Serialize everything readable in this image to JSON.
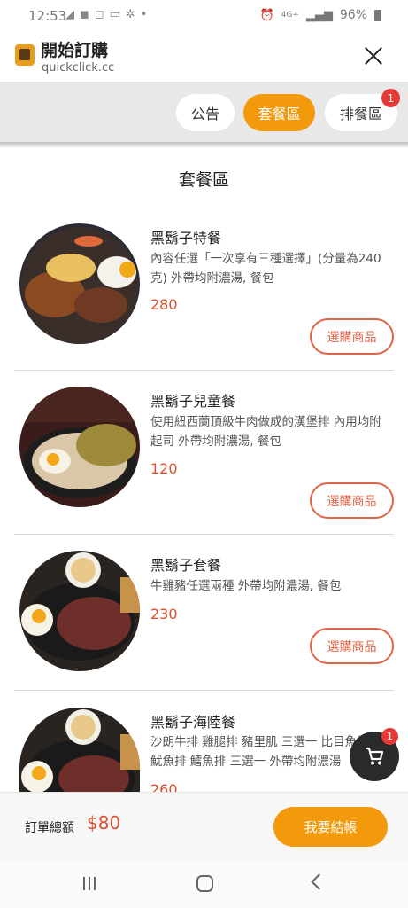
{
  "status_bar": {
    "time": "12:53",
    "left_icons": [
      "telegram-icon",
      "facebook-icon",
      "instagram-icon",
      "line-icon",
      "pinwheel-icon",
      "dot-icon"
    ],
    "signal_text": "4G+",
    "battery": "96%"
  },
  "browser": {
    "title": "開始訂購",
    "url": "quickclick.cc"
  },
  "tabs": [
    {
      "label": "公告",
      "active": false
    },
    {
      "label": "套餐區",
      "active": true
    },
    {
      "label": "排餐區",
      "active": false,
      "badge": "1"
    }
  ],
  "section_title": "套餐區",
  "items": [
    {
      "name": "黑鬍子特餐",
      "desc": "內容任選「一次享有三種選擇」(分量為240克) 外帶均附濃湯, 餐包",
      "price": "280",
      "button": "選購商品"
    },
    {
      "name": "黑鬍子兒童餐",
      "desc": "使用紐西蘭頂級牛肉做成的漢堡排 內用均附起司 外帶均附濃湯, 餐包",
      "price": "120",
      "button": "選購商品"
    },
    {
      "name": "黑鬍子套餐",
      "desc": "牛雞豬任選兩種 外帶均附濃湯, 餐包",
      "price": "230",
      "button": "選購商品"
    },
    {
      "name": "黑鬍子海陸餐",
      "desc": "沙朗牛排 雞腿排 豬里肌 三選一 比目魚排 魷魚排 鱈魚排 三選一 外帶均附濃湯",
      "price": "260"
    }
  ],
  "cart": {
    "badge": "1"
  },
  "order_bar": {
    "label": "訂單總額",
    "total": "$80",
    "checkout": "我要結帳"
  },
  "colors": {
    "accent_orange": "#f39a0c",
    "price_red": "#d9502f",
    "badge_red": "#e53935"
  }
}
